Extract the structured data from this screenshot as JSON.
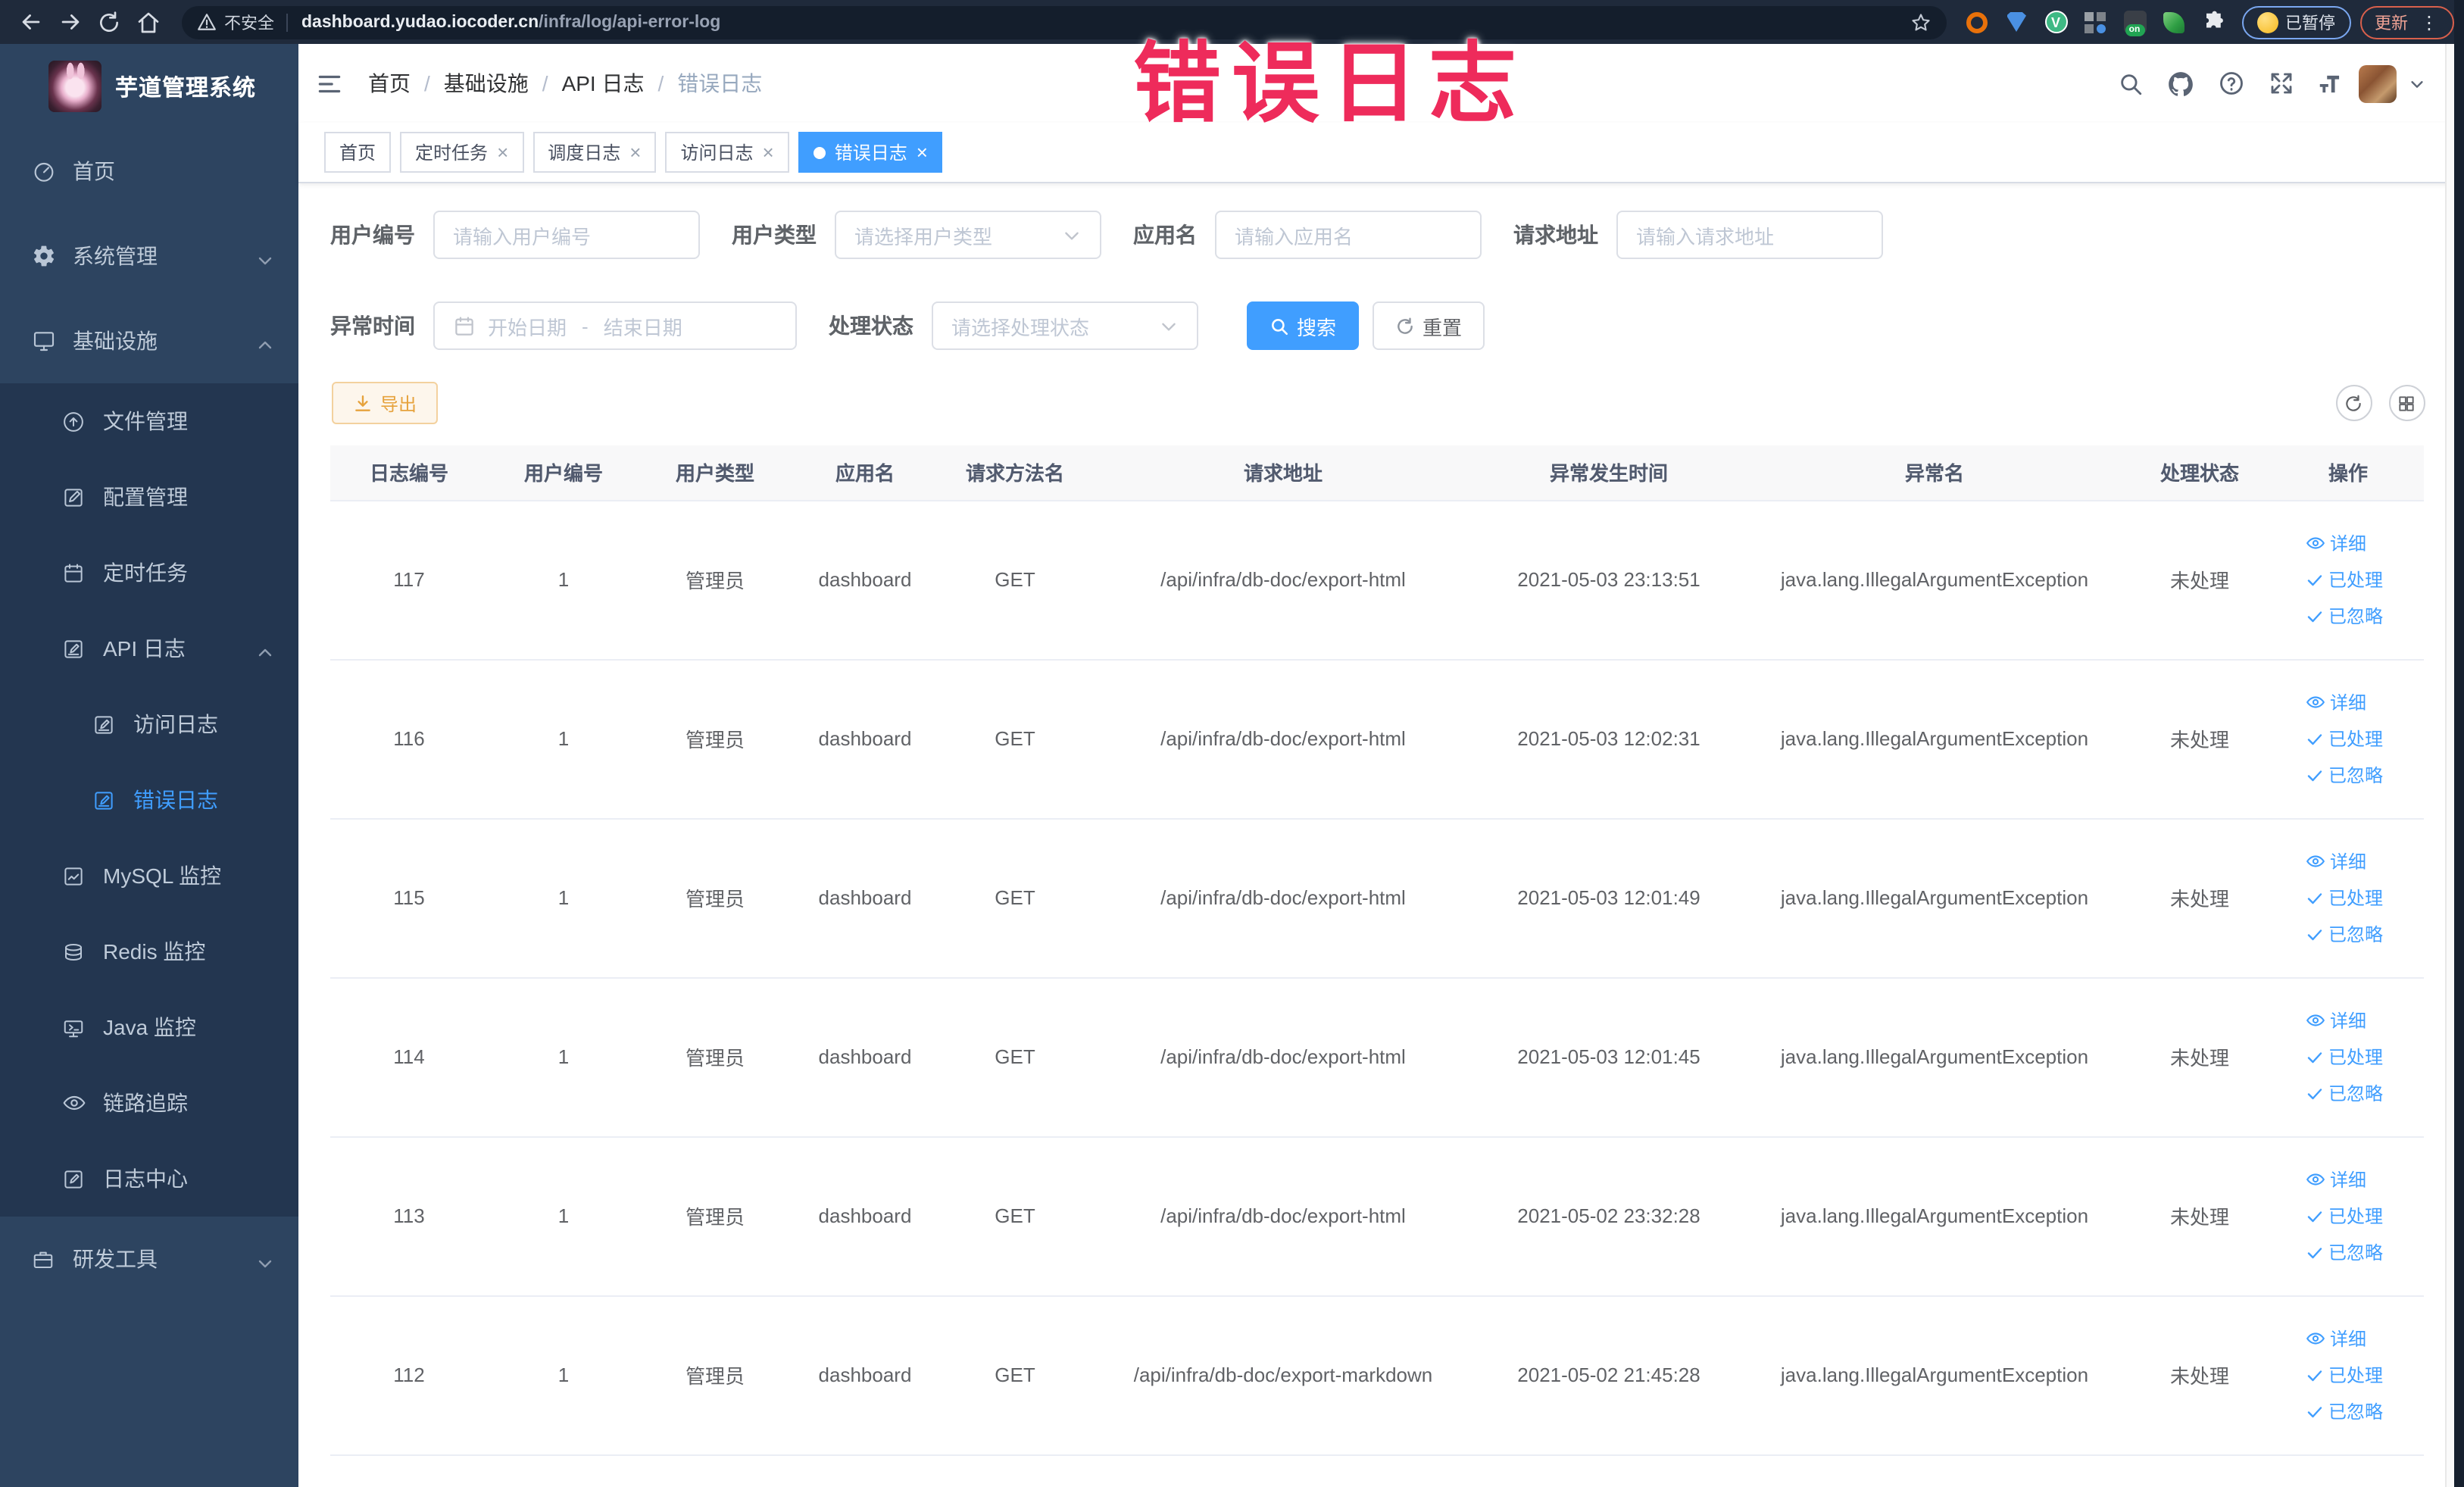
{
  "browser": {
    "security_label": "不安全",
    "url_host": "dashboard.yudao.iocoder.cn",
    "url_path": "/infra/log/api-error-log",
    "nav_icons": [
      "back-arrow-icon",
      "forward-arrow-icon",
      "reload-icon",
      "home-icon"
    ],
    "extensions": [
      "orange-extension-icon",
      "shield-extension-icon",
      "vue-devtools-icon",
      "tabs-grid-icon",
      "switch-on-icon",
      "leaf-extension-icon",
      "puzzle-extension-icon"
    ],
    "paused_button": "已暂停",
    "update_button": "更新"
  },
  "overlay_text": "错误日志",
  "sidebar": {
    "logo_title": "芋道管理系统",
    "menu": [
      {
        "label": "首页",
        "icon": "dashboard-icon",
        "level": 1,
        "bg": "base",
        "chevron": ""
      },
      {
        "label": "系统管理",
        "icon": "gear-icon",
        "level": 1,
        "bg": "base",
        "chevron": "down"
      },
      {
        "label": "基础设施",
        "icon": "monitor-icon",
        "level": 1,
        "bg": "base",
        "chevron": "up"
      },
      {
        "label": "文件管理",
        "icon": "file-icon",
        "level": 2,
        "bg": "dark",
        "chevron": ""
      },
      {
        "label": "配置管理",
        "icon": "edit-box-icon",
        "level": 2,
        "bg": "dark",
        "chevron": ""
      },
      {
        "label": "定时任务",
        "icon": "clock-icon",
        "level": 2,
        "bg": "dark",
        "chevron": ""
      },
      {
        "label": "API 日志",
        "icon": "log-icon",
        "level": 2,
        "bg": "dark",
        "chevron": "up"
      },
      {
        "label": "访问日志",
        "icon": "log-icon",
        "level": 3,
        "bg": "dark",
        "chevron": ""
      },
      {
        "label": "错误日志",
        "icon": "log-icon",
        "level": 3,
        "bg": "dark",
        "chevron": "",
        "active": true
      },
      {
        "label": "MySQL 监控",
        "icon": "mysql-icon",
        "level": 2,
        "bg": "dark",
        "chevron": ""
      },
      {
        "label": "Redis 监控",
        "icon": "redis-icon",
        "level": 2,
        "bg": "dark",
        "chevron": ""
      },
      {
        "label": "Java 监控",
        "icon": "java-icon",
        "level": 2,
        "bg": "dark",
        "chevron": ""
      },
      {
        "label": "链路追踪",
        "icon": "trace-icon",
        "level": 2,
        "bg": "dark",
        "chevron": ""
      },
      {
        "label": "日志中心",
        "icon": "log-center-icon",
        "level": 2,
        "bg": "dark",
        "chevron": ""
      },
      {
        "label": "研发工具",
        "icon": "tools-icon",
        "level": 1,
        "bg": "base",
        "chevron": "down"
      }
    ]
  },
  "header": {
    "breadcrumb": [
      "首页",
      "基础设施",
      "API 日志",
      "错误日志"
    ],
    "icons": [
      "search-icon",
      "github-icon",
      "docs-icon",
      "fullscreen-icon",
      "font-size-icon"
    ]
  },
  "tabs": [
    {
      "label": "首页",
      "closable": false,
      "active": false
    },
    {
      "label": "定时任务",
      "closable": true,
      "active": false
    },
    {
      "label": "调度日志",
      "closable": true,
      "active": false
    },
    {
      "label": "访问日志",
      "closable": true,
      "active": false
    },
    {
      "label": "错误日志",
      "closable": true,
      "active": true
    }
  ],
  "filters": {
    "row1": [
      {
        "label": "用户编号",
        "placeholder": "请输入用户编号",
        "type": "input",
        "name": "user-id"
      },
      {
        "label": "用户类型",
        "placeholder": "请选择用户类型",
        "type": "select",
        "name": "user-type"
      },
      {
        "label": "应用名",
        "placeholder": "请输入应用名",
        "type": "input",
        "name": "app-name"
      },
      {
        "label": "请求地址",
        "placeholder": "请输入请求地址",
        "type": "input",
        "name": "request-url"
      }
    ],
    "row2": [
      {
        "label": "异常时间",
        "type": "daterange",
        "start_placeholder": "开始日期",
        "end_placeholder": "结束日期",
        "separator": "-",
        "name": "exception-time"
      },
      {
        "label": "处理状态",
        "placeholder": "请选择处理状态",
        "type": "select",
        "name": "process-status"
      }
    ],
    "search_button": "搜索",
    "reset_button": "重置"
  },
  "toolbar": {
    "export_button": "导出"
  },
  "table": {
    "columns": [
      "日志编号",
      "用户编号",
      "用户类型",
      "应用名",
      "请求方法名",
      "请求地址",
      "异常发生时间",
      "异常名",
      "处理状态",
      "操作"
    ],
    "action_labels": [
      "详细",
      "已处理",
      "已忽略"
    ],
    "action_icons": [
      "eye-icon",
      "check-icon",
      "check-icon"
    ],
    "rows": [
      [
        "117",
        "1",
        "管理员",
        "dashboard",
        "GET",
        "/api/infra/db-doc/export-html",
        "2021-05-03 23:13:51",
        "java.lang.IllegalArgumentException",
        "未处理"
      ],
      [
        "116",
        "1",
        "管理员",
        "dashboard",
        "GET",
        "/api/infra/db-doc/export-html",
        "2021-05-03 12:02:31",
        "java.lang.IllegalArgumentException",
        "未处理"
      ],
      [
        "115",
        "1",
        "管理员",
        "dashboard",
        "GET",
        "/api/infra/db-doc/export-html",
        "2021-05-03 12:01:49",
        "java.lang.IllegalArgumentException",
        "未处理"
      ],
      [
        "114",
        "1",
        "管理员",
        "dashboard",
        "GET",
        "/api/infra/db-doc/export-html",
        "2021-05-03 12:01:45",
        "java.lang.IllegalArgumentException",
        "未处理"
      ],
      [
        "113",
        "1",
        "管理员",
        "dashboard",
        "GET",
        "/api/infra/db-doc/export-html",
        "2021-05-02 23:32:28",
        "java.lang.IllegalArgumentException",
        "未处理"
      ],
      [
        "112",
        "1",
        "管理员",
        "dashboard",
        "GET",
        "/api/infra/db-doc/export-markdown",
        "2021-05-02 21:45:28",
        "java.lang.IllegalArgumentException",
        "未处理"
      ]
    ]
  },
  "colors": {
    "accent": "#409eff",
    "overlay_red": "#ee2b5b",
    "warning": "#e6a23c"
  }
}
